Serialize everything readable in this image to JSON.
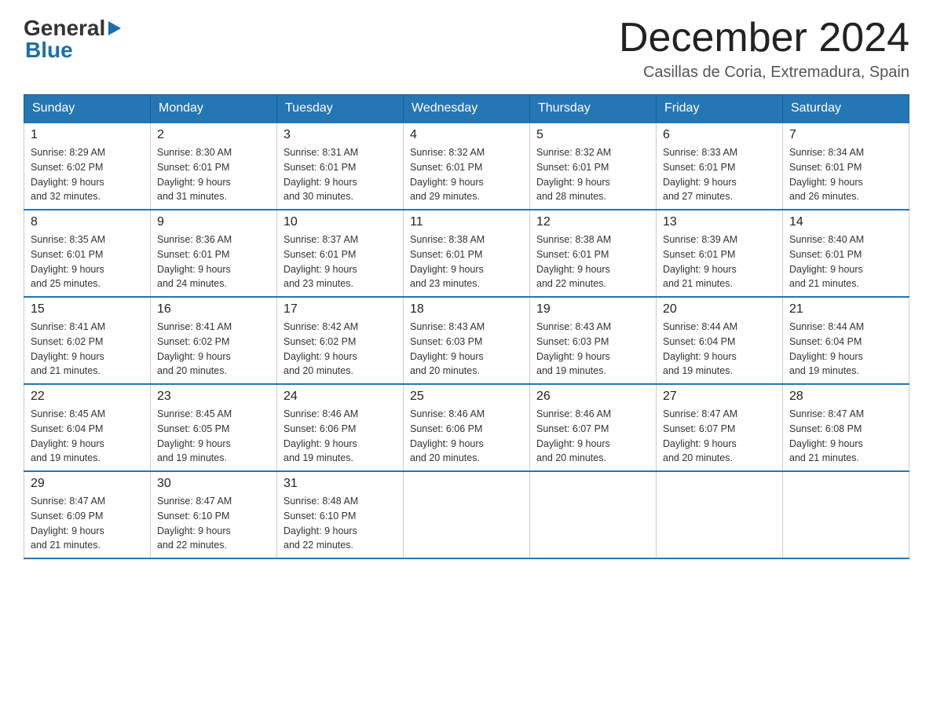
{
  "logo": {
    "general": "General",
    "blue": "Blue",
    "arrow": "▶"
  },
  "title": "December 2024",
  "subtitle": "Casillas de Coria, Extremadura, Spain",
  "days_of_week": [
    "Sunday",
    "Monday",
    "Tuesday",
    "Wednesday",
    "Thursday",
    "Friday",
    "Saturday"
  ],
  "weeks": [
    [
      {
        "day": "1",
        "sunrise": "8:29 AM",
        "sunset": "6:02 PM",
        "daylight": "9 hours and 32 minutes."
      },
      {
        "day": "2",
        "sunrise": "8:30 AM",
        "sunset": "6:01 PM",
        "daylight": "9 hours and 31 minutes."
      },
      {
        "day": "3",
        "sunrise": "8:31 AM",
        "sunset": "6:01 PM",
        "daylight": "9 hours and 30 minutes."
      },
      {
        "day": "4",
        "sunrise": "8:32 AM",
        "sunset": "6:01 PM",
        "daylight": "9 hours and 29 minutes."
      },
      {
        "day": "5",
        "sunrise": "8:32 AM",
        "sunset": "6:01 PM",
        "daylight": "9 hours and 28 minutes."
      },
      {
        "day": "6",
        "sunrise": "8:33 AM",
        "sunset": "6:01 PM",
        "daylight": "9 hours and 27 minutes."
      },
      {
        "day": "7",
        "sunrise": "8:34 AM",
        "sunset": "6:01 PM",
        "daylight": "9 hours and 26 minutes."
      }
    ],
    [
      {
        "day": "8",
        "sunrise": "8:35 AM",
        "sunset": "6:01 PM",
        "daylight": "9 hours and 25 minutes."
      },
      {
        "day": "9",
        "sunrise": "8:36 AM",
        "sunset": "6:01 PM",
        "daylight": "9 hours and 24 minutes."
      },
      {
        "day": "10",
        "sunrise": "8:37 AM",
        "sunset": "6:01 PM",
        "daylight": "9 hours and 23 minutes."
      },
      {
        "day": "11",
        "sunrise": "8:38 AM",
        "sunset": "6:01 PM",
        "daylight": "9 hours and 23 minutes."
      },
      {
        "day": "12",
        "sunrise": "8:38 AM",
        "sunset": "6:01 PM",
        "daylight": "9 hours and 22 minutes."
      },
      {
        "day": "13",
        "sunrise": "8:39 AM",
        "sunset": "6:01 PM",
        "daylight": "9 hours and 21 minutes."
      },
      {
        "day": "14",
        "sunrise": "8:40 AM",
        "sunset": "6:01 PM",
        "daylight": "9 hours and 21 minutes."
      }
    ],
    [
      {
        "day": "15",
        "sunrise": "8:41 AM",
        "sunset": "6:02 PM",
        "daylight": "9 hours and 21 minutes."
      },
      {
        "day": "16",
        "sunrise": "8:41 AM",
        "sunset": "6:02 PM",
        "daylight": "9 hours and 20 minutes."
      },
      {
        "day": "17",
        "sunrise": "8:42 AM",
        "sunset": "6:02 PM",
        "daylight": "9 hours and 20 minutes."
      },
      {
        "day": "18",
        "sunrise": "8:43 AM",
        "sunset": "6:03 PM",
        "daylight": "9 hours and 20 minutes."
      },
      {
        "day": "19",
        "sunrise": "8:43 AM",
        "sunset": "6:03 PM",
        "daylight": "9 hours and 19 minutes."
      },
      {
        "day": "20",
        "sunrise": "8:44 AM",
        "sunset": "6:04 PM",
        "daylight": "9 hours and 19 minutes."
      },
      {
        "day": "21",
        "sunrise": "8:44 AM",
        "sunset": "6:04 PM",
        "daylight": "9 hours and 19 minutes."
      }
    ],
    [
      {
        "day": "22",
        "sunrise": "8:45 AM",
        "sunset": "6:04 PM",
        "daylight": "9 hours and 19 minutes."
      },
      {
        "day": "23",
        "sunrise": "8:45 AM",
        "sunset": "6:05 PM",
        "daylight": "9 hours and 19 minutes."
      },
      {
        "day": "24",
        "sunrise": "8:46 AM",
        "sunset": "6:06 PM",
        "daylight": "9 hours and 19 minutes."
      },
      {
        "day": "25",
        "sunrise": "8:46 AM",
        "sunset": "6:06 PM",
        "daylight": "9 hours and 20 minutes."
      },
      {
        "day": "26",
        "sunrise": "8:46 AM",
        "sunset": "6:07 PM",
        "daylight": "9 hours and 20 minutes."
      },
      {
        "day": "27",
        "sunrise": "8:47 AM",
        "sunset": "6:07 PM",
        "daylight": "9 hours and 20 minutes."
      },
      {
        "day": "28",
        "sunrise": "8:47 AM",
        "sunset": "6:08 PM",
        "daylight": "9 hours and 21 minutes."
      }
    ],
    [
      {
        "day": "29",
        "sunrise": "8:47 AM",
        "sunset": "6:09 PM",
        "daylight": "9 hours and 21 minutes."
      },
      {
        "day": "30",
        "sunrise": "8:47 AM",
        "sunset": "6:10 PM",
        "daylight": "9 hours and 22 minutes."
      },
      {
        "day": "31",
        "sunrise": "8:48 AM",
        "sunset": "6:10 PM",
        "daylight": "9 hours and 22 minutes."
      },
      null,
      null,
      null,
      null
    ]
  ],
  "labels": {
    "sunrise": "Sunrise:",
    "sunset": "Sunset:",
    "daylight": "Daylight:"
  }
}
